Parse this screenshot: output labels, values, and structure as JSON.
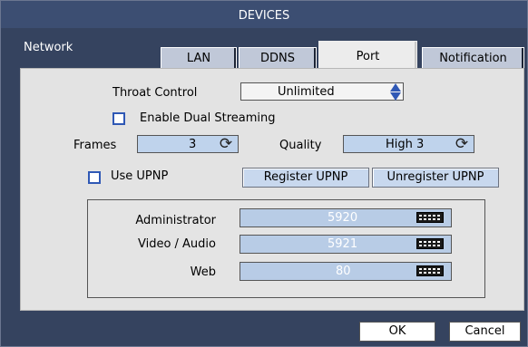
{
  "window": {
    "title": "DEVICES",
    "section": "Network"
  },
  "tabs": [
    {
      "label": "LAN"
    },
    {
      "label": "DDNS"
    },
    {
      "label": "Port",
      "active": true
    },
    {
      "label": "Notification"
    }
  ],
  "port": {
    "throat_control_label": "Throat Control",
    "throat_control_value": "Unlimited",
    "dual_streaming_label": "Enable Dual Streaming",
    "frames_label": "Frames",
    "frames_value": "3",
    "quality_label": "Quality",
    "quality_value": "High 3",
    "use_upnp_label": "Use UPNP",
    "register_upnp_label": "Register UPNP",
    "unregister_upnp_label": "Unregister UPNP",
    "administrator_label": "Administrator",
    "administrator_value": "5920",
    "video_audio_label": "Video / Audio",
    "video_audio_value": "5921",
    "web_label": "Web",
    "web_value": "80"
  },
  "footer": {
    "ok_label": "OK",
    "cancel_label": "Cancel"
  },
  "colors": {
    "frame": "#35435f",
    "panel": "#e3e3e3",
    "field_blue": "#bfd3ec",
    "accent": "#2f58b5"
  },
  "icons": [
    "spinner-icon",
    "cycle-icon",
    "keyboard-icon",
    "checkbox-icon"
  ]
}
